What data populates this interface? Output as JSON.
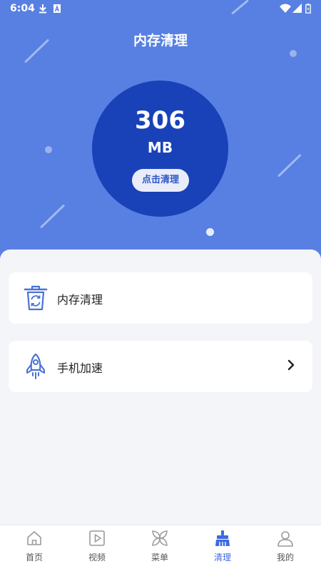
{
  "status_bar": {
    "time": "6:04"
  },
  "header": {
    "title": "内存清理"
  },
  "memory": {
    "value": "306",
    "unit": "MB",
    "clean_button": "点击清理"
  },
  "cards": [
    {
      "label": "内存清理",
      "icon": "trash-recycle-icon"
    },
    {
      "label": "手机加速",
      "icon": "rocket-icon"
    }
  ],
  "nav": [
    {
      "label": "首页",
      "icon": "home-icon"
    },
    {
      "label": "视频",
      "icon": "video-play-icon"
    },
    {
      "label": "菜单",
      "icon": "menu-flower-icon"
    },
    {
      "label": "清理",
      "icon": "broom-icon",
      "active": true
    },
    {
      "label": "我的",
      "icon": "user-icon"
    }
  ],
  "colors": {
    "primary": "#5880e2",
    "circle": "#1942b8",
    "active": "#3f69e0"
  }
}
